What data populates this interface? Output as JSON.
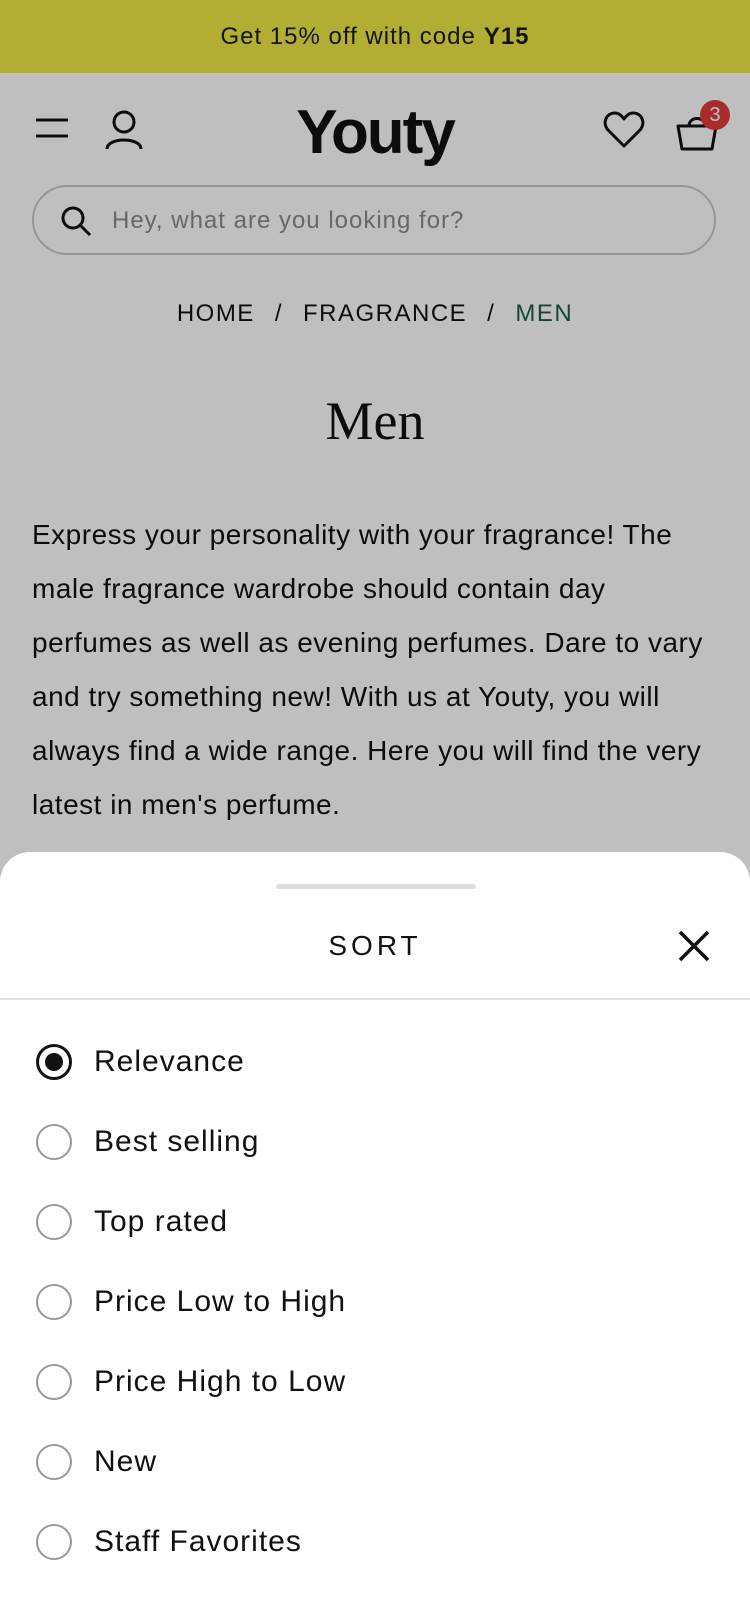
{
  "promo": {
    "text": "Get 15% off with code",
    "code": "Y15"
  },
  "header": {
    "logo": "Youty",
    "cart_count": "3",
    "icons": [
      "menu-icon",
      "account-icon",
      "heart-icon",
      "basket-icon"
    ]
  },
  "search": {
    "placeholder": "Hey, what are you looking for?",
    "value": ""
  },
  "breadcrumb": {
    "items": [
      "HOME",
      "FRAGRANCE",
      "MEN"
    ],
    "separator": "/"
  },
  "category": {
    "title": "Men",
    "description": "Express your personality with your fragrance! The male fragrance wardrobe should contain day perfumes as well as evening perfumes. Dare to vary and try something new! With us at Youty, you will always find a wide range. Here you will find the very latest in men's perfume."
  },
  "sort_sheet": {
    "title": "SORT",
    "selected": "Relevance",
    "options": [
      {
        "label": "Relevance"
      },
      {
        "label": "Best selling"
      },
      {
        "label": "Top rated"
      },
      {
        "label": "Price Low to High"
      },
      {
        "label": "Price High to Low"
      },
      {
        "label": "New"
      },
      {
        "label": "Staff Favorites"
      }
    ]
  },
  "colors": {
    "promo_bg": "#eee946",
    "breadcrumb_current": "#1e5c43",
    "badge": "#e23b3b"
  }
}
